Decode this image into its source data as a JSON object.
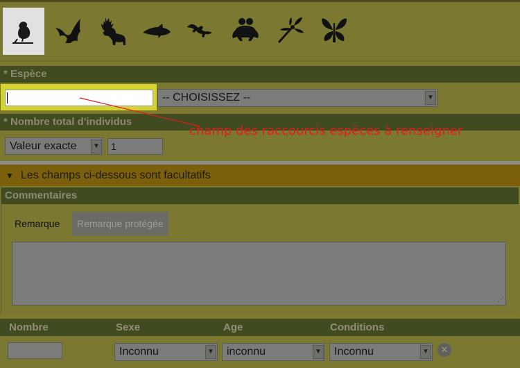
{
  "icons": [
    {
      "name": "bird-icon",
      "label": "Oiseaux",
      "selected": true
    },
    {
      "name": "bat-icon",
      "label": "Chauves-souris",
      "selected": false
    },
    {
      "name": "deer-icon",
      "label": "Mammifères",
      "selected": false
    },
    {
      "name": "fish-icon",
      "label": "Poissons",
      "selected": false
    },
    {
      "name": "lizard-icon",
      "label": "Reptiles",
      "selected": false
    },
    {
      "name": "frog-icon",
      "label": "Amphibiens",
      "selected": false
    },
    {
      "name": "dragonfly-icon",
      "label": "Libellules",
      "selected": false
    },
    {
      "name": "butterfly-icon",
      "label": "Papillons",
      "selected": false
    }
  ],
  "species": {
    "heading": "* Espèce",
    "shortcut_value": "",
    "select_value": "-- CHOISISSEZ --"
  },
  "count": {
    "heading": "* Nombre total d'individus",
    "mode_value": "Valeur exacte",
    "value": "1"
  },
  "annotation": "champ des raccourcis espèces à renseigner",
  "optional": {
    "toggle_label": "Les champs ci-dessous sont facultatifs",
    "comments_heading": "Commentaires",
    "tabs": [
      "Remarque",
      "Remarque protégée"
    ],
    "remark_text": ""
  },
  "detail_table": {
    "headers": [
      "Nombre",
      "Sexe",
      "Age",
      "Conditions"
    ],
    "row": {
      "nombre": "",
      "sexe": "Inconnu",
      "age": "inconnu",
      "conditions": "Inconnu"
    },
    "clear_symbol": "✕"
  },
  "colors": {
    "highlight": "#d5d32e",
    "annotation": "#e21b1b",
    "optional_bar": "#7b5f0b",
    "section_header": "#404c20"
  }
}
